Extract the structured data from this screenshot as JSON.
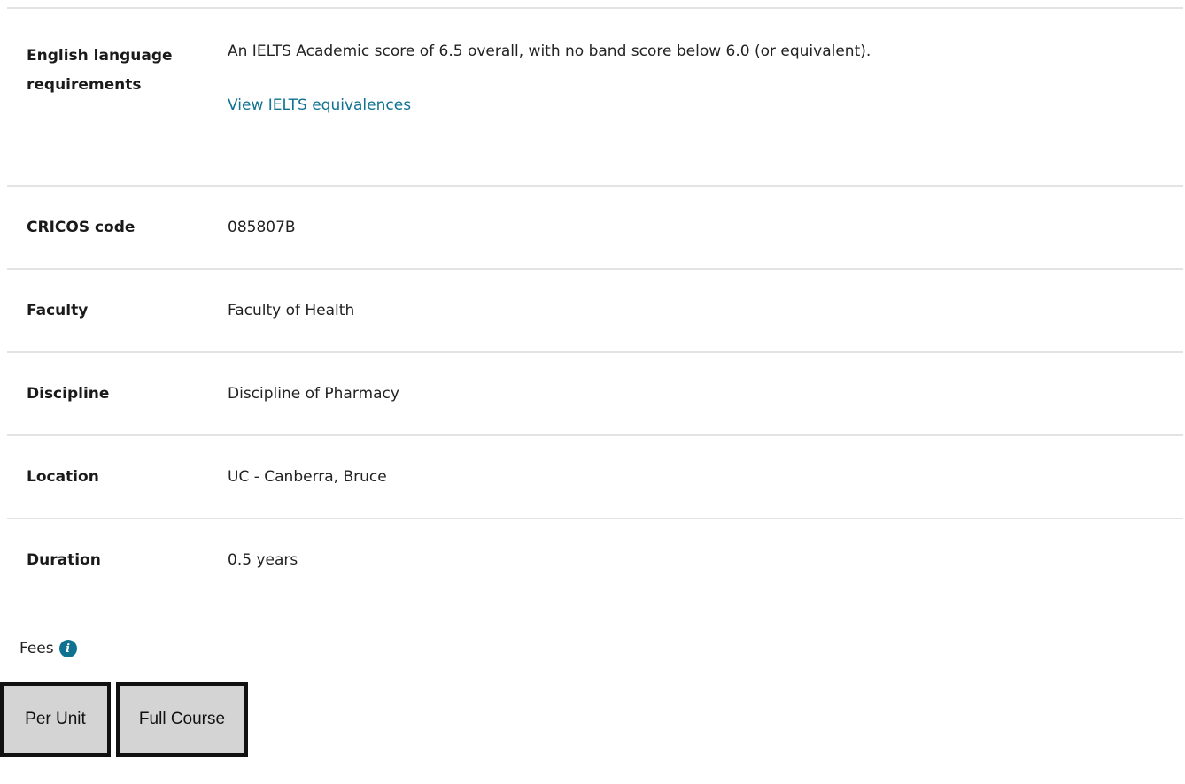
{
  "details": {
    "rows": [
      {
        "label": "English language requirements",
        "value": "An IELTS Academic score of 6.5 overall, with no band score below 6.0 (or equivalent).",
        "link": "View IELTS equivalences"
      },
      {
        "label": "CRICOS code",
        "value": "085807B"
      },
      {
        "label": "Faculty",
        "value": "Faculty of Health"
      },
      {
        "label": "Discipline",
        "value": "Discipline of Pharmacy"
      },
      {
        "label": "Location",
        "value": "UC - Canberra, Bruce"
      },
      {
        "label": "Duration",
        "value": "0.5 years"
      }
    ]
  },
  "fees": {
    "label": "Fees",
    "icon": "info-icon",
    "tabs": [
      "Per Unit",
      "Full Course"
    ]
  },
  "colors": {
    "link": "#0f7290",
    "divider": "#e3e3e3",
    "tab_bg": "#d4d4d4",
    "tab_border": "#111111"
  }
}
